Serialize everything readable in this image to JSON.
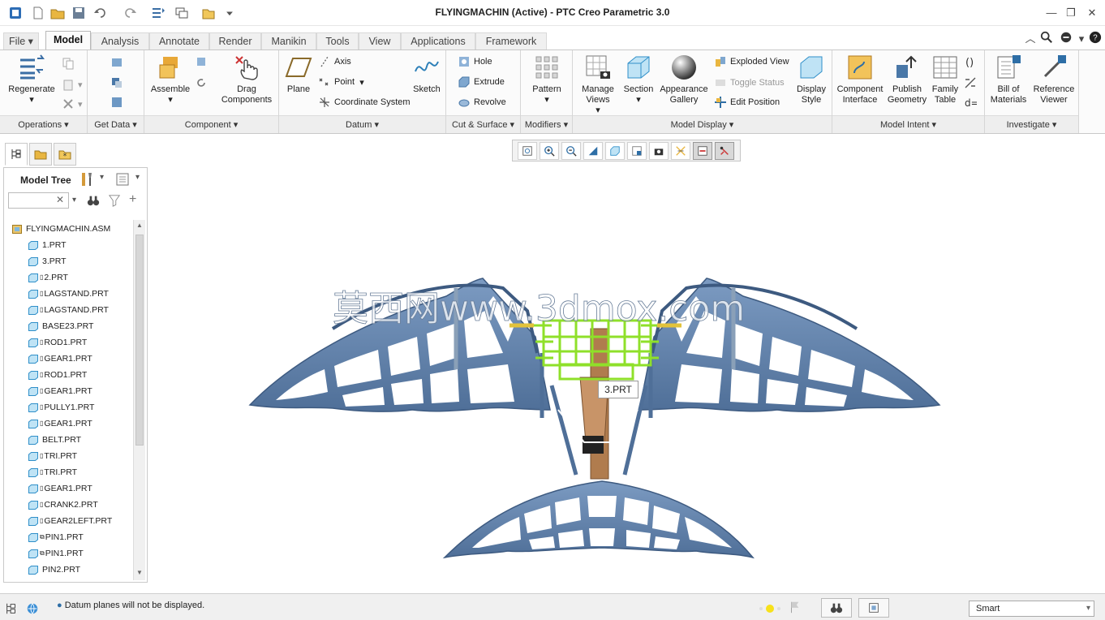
{
  "window": {
    "title": "FLYINGMACHIN (Active) - PTC Creo Parametric 3.0"
  },
  "tabs": [
    {
      "label": "File",
      "name": "tab-file"
    },
    {
      "label": "Model",
      "name": "tab-model"
    },
    {
      "label": "Analysis",
      "name": "tab-analysis"
    },
    {
      "label": "Annotate",
      "name": "tab-annotate"
    },
    {
      "label": "Render",
      "name": "tab-render"
    },
    {
      "label": "Manikin",
      "name": "tab-manikin"
    },
    {
      "label": "Tools",
      "name": "tab-tools"
    },
    {
      "label": "View",
      "name": "tab-view"
    },
    {
      "label": "Applications",
      "name": "tab-applications"
    },
    {
      "label": "Framework",
      "name": "tab-framework"
    }
  ],
  "ribbon": {
    "groups": {
      "operations": "Operations",
      "get_data": "Get Data",
      "component": "Component",
      "datum": "Datum",
      "cut_surface": "Cut & Surface",
      "modifiers": "Modifiers",
      "model_display": "Model Display",
      "model_intent": "Model Intent",
      "investigate": "Investigate"
    },
    "regenerate": "Regenerate",
    "assemble": "Assemble",
    "drag_components": "Drag Components",
    "plane": "Plane",
    "axis": "Axis",
    "point": "Point",
    "coordinate_system": "Coordinate System",
    "sketch": "Sketch",
    "hole": "Hole",
    "extrude": "Extrude",
    "revolve": "Revolve",
    "pattern": "Pattern",
    "manage_views": "Manage Views",
    "section": "Section",
    "appearance_gallery": "Appearance Gallery",
    "exploded_view": "Exploded View",
    "toggle_status": "Toggle Status",
    "edit_position": "Edit Position",
    "display_style": "Display Style",
    "component_interface": "Component Interface",
    "publish_geometry": "Publish Geometry",
    "family_table": "Family Table",
    "bill_of_materials": "Bill of Materials",
    "reference_viewer": "Reference Viewer"
  },
  "model_tree": {
    "title": "Model Tree",
    "search_value": "",
    "root": "FLYINGMACHIN.ASM",
    "items": [
      {
        "label": "1.PRT",
        "flag": ""
      },
      {
        "label": "3.PRT",
        "flag": ""
      },
      {
        "label": "2.PRT",
        "flag": "▯"
      },
      {
        "label": "LAGSTAND.PRT",
        "flag": "▯"
      },
      {
        "label": "LAGSTAND.PRT",
        "flag": "▯"
      },
      {
        "label": "BASE23.PRT",
        "flag": ""
      },
      {
        "label": "ROD1.PRT",
        "flag": "▯"
      },
      {
        "label": "GEAR1.PRT",
        "flag": "▯"
      },
      {
        "label": "ROD1.PRT",
        "flag": "▯"
      },
      {
        "label": "GEAR1.PRT",
        "flag": "▯"
      },
      {
        "label": "PULLY1.PRT",
        "flag": "▯"
      },
      {
        "label": "GEAR1.PRT",
        "flag": "▯"
      },
      {
        "label": "BELT.PRT",
        "flag": ""
      },
      {
        "label": "TRI.PRT",
        "flag": "▯"
      },
      {
        "label": "TRI.PRT",
        "flag": "▯"
      },
      {
        "label": "GEAR1.PRT",
        "flag": "▯"
      },
      {
        "label": "CRANK2.PRT",
        "flag": "▯"
      },
      {
        "label": "GEAR2LEFT.PRT",
        "flag": "▯"
      },
      {
        "label": "PIN1.PRT",
        "flag": "⧉"
      },
      {
        "label": "PIN1.PRT",
        "flag": "⧉"
      },
      {
        "label": "PIN2.PRT",
        "flag": ""
      }
    ]
  },
  "graphics": {
    "tooltip": "3.PRT",
    "watermark": "莫西网www.3dmox.com"
  },
  "status": {
    "message": "Datum planes will not be displayed.",
    "filter": "Smart"
  },
  "colors": {
    "model_blue": "#5f7fa8",
    "highlight_green": "#8fe02a",
    "body_brown": "#b07c4e"
  }
}
